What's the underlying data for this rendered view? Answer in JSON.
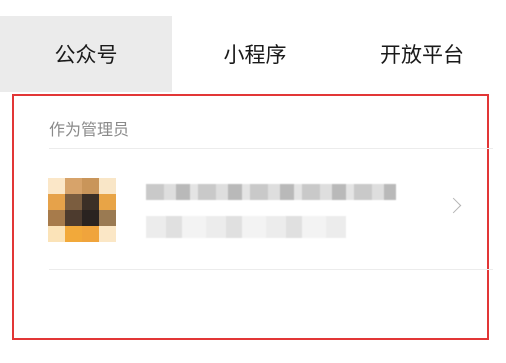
{
  "tabs": [
    {
      "label": "公众号",
      "active": true
    },
    {
      "label": "小程序",
      "active": false
    },
    {
      "label": "开放平台",
      "active": false
    }
  ],
  "section": {
    "title": "作为管理员"
  },
  "account": {
    "name": "",
    "description": "",
    "chevron": "chevron-right-icon"
  },
  "colors": {
    "highlight_border": "#e23636",
    "active_tab_bg": "#ebebeb"
  }
}
